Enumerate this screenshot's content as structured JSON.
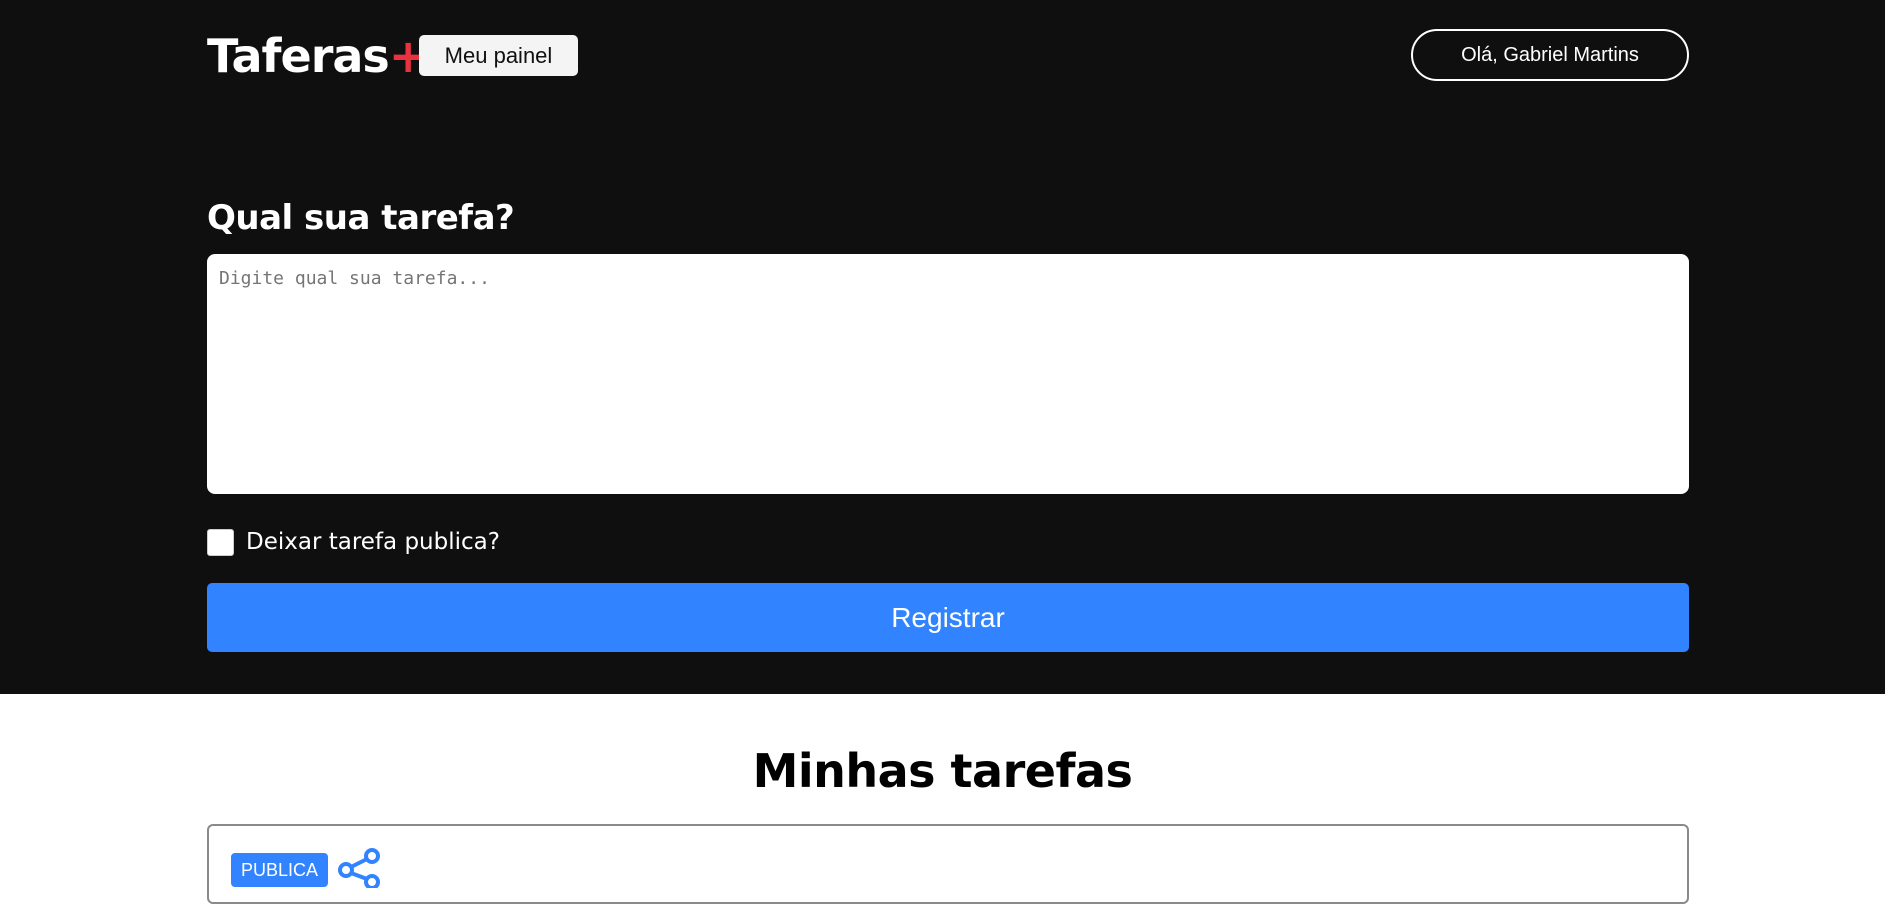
{
  "header": {
    "logo_text": "Taferas",
    "logo_plus": "+",
    "panel_button": "Meu painel",
    "user_button": "Olá, Gabriel Martins"
  },
  "form": {
    "title": "Qual sua tarefa?",
    "textarea_value": "",
    "textarea_placeholder": "Digite qual sua tarefa...",
    "public_label": "Deixar tarefa publica?",
    "public_checked": false,
    "submit_label": "Registrar"
  },
  "tasks": {
    "title": "Minhas tarefas",
    "items": [
      {
        "badge": "PUBLICA",
        "icon": "share-icon"
      }
    ]
  },
  "colors": {
    "background_dark": "#0f0f0f",
    "accent_blue": "#3183ff",
    "logo_plus_red": "#ea3140",
    "white": "#ffffff"
  }
}
